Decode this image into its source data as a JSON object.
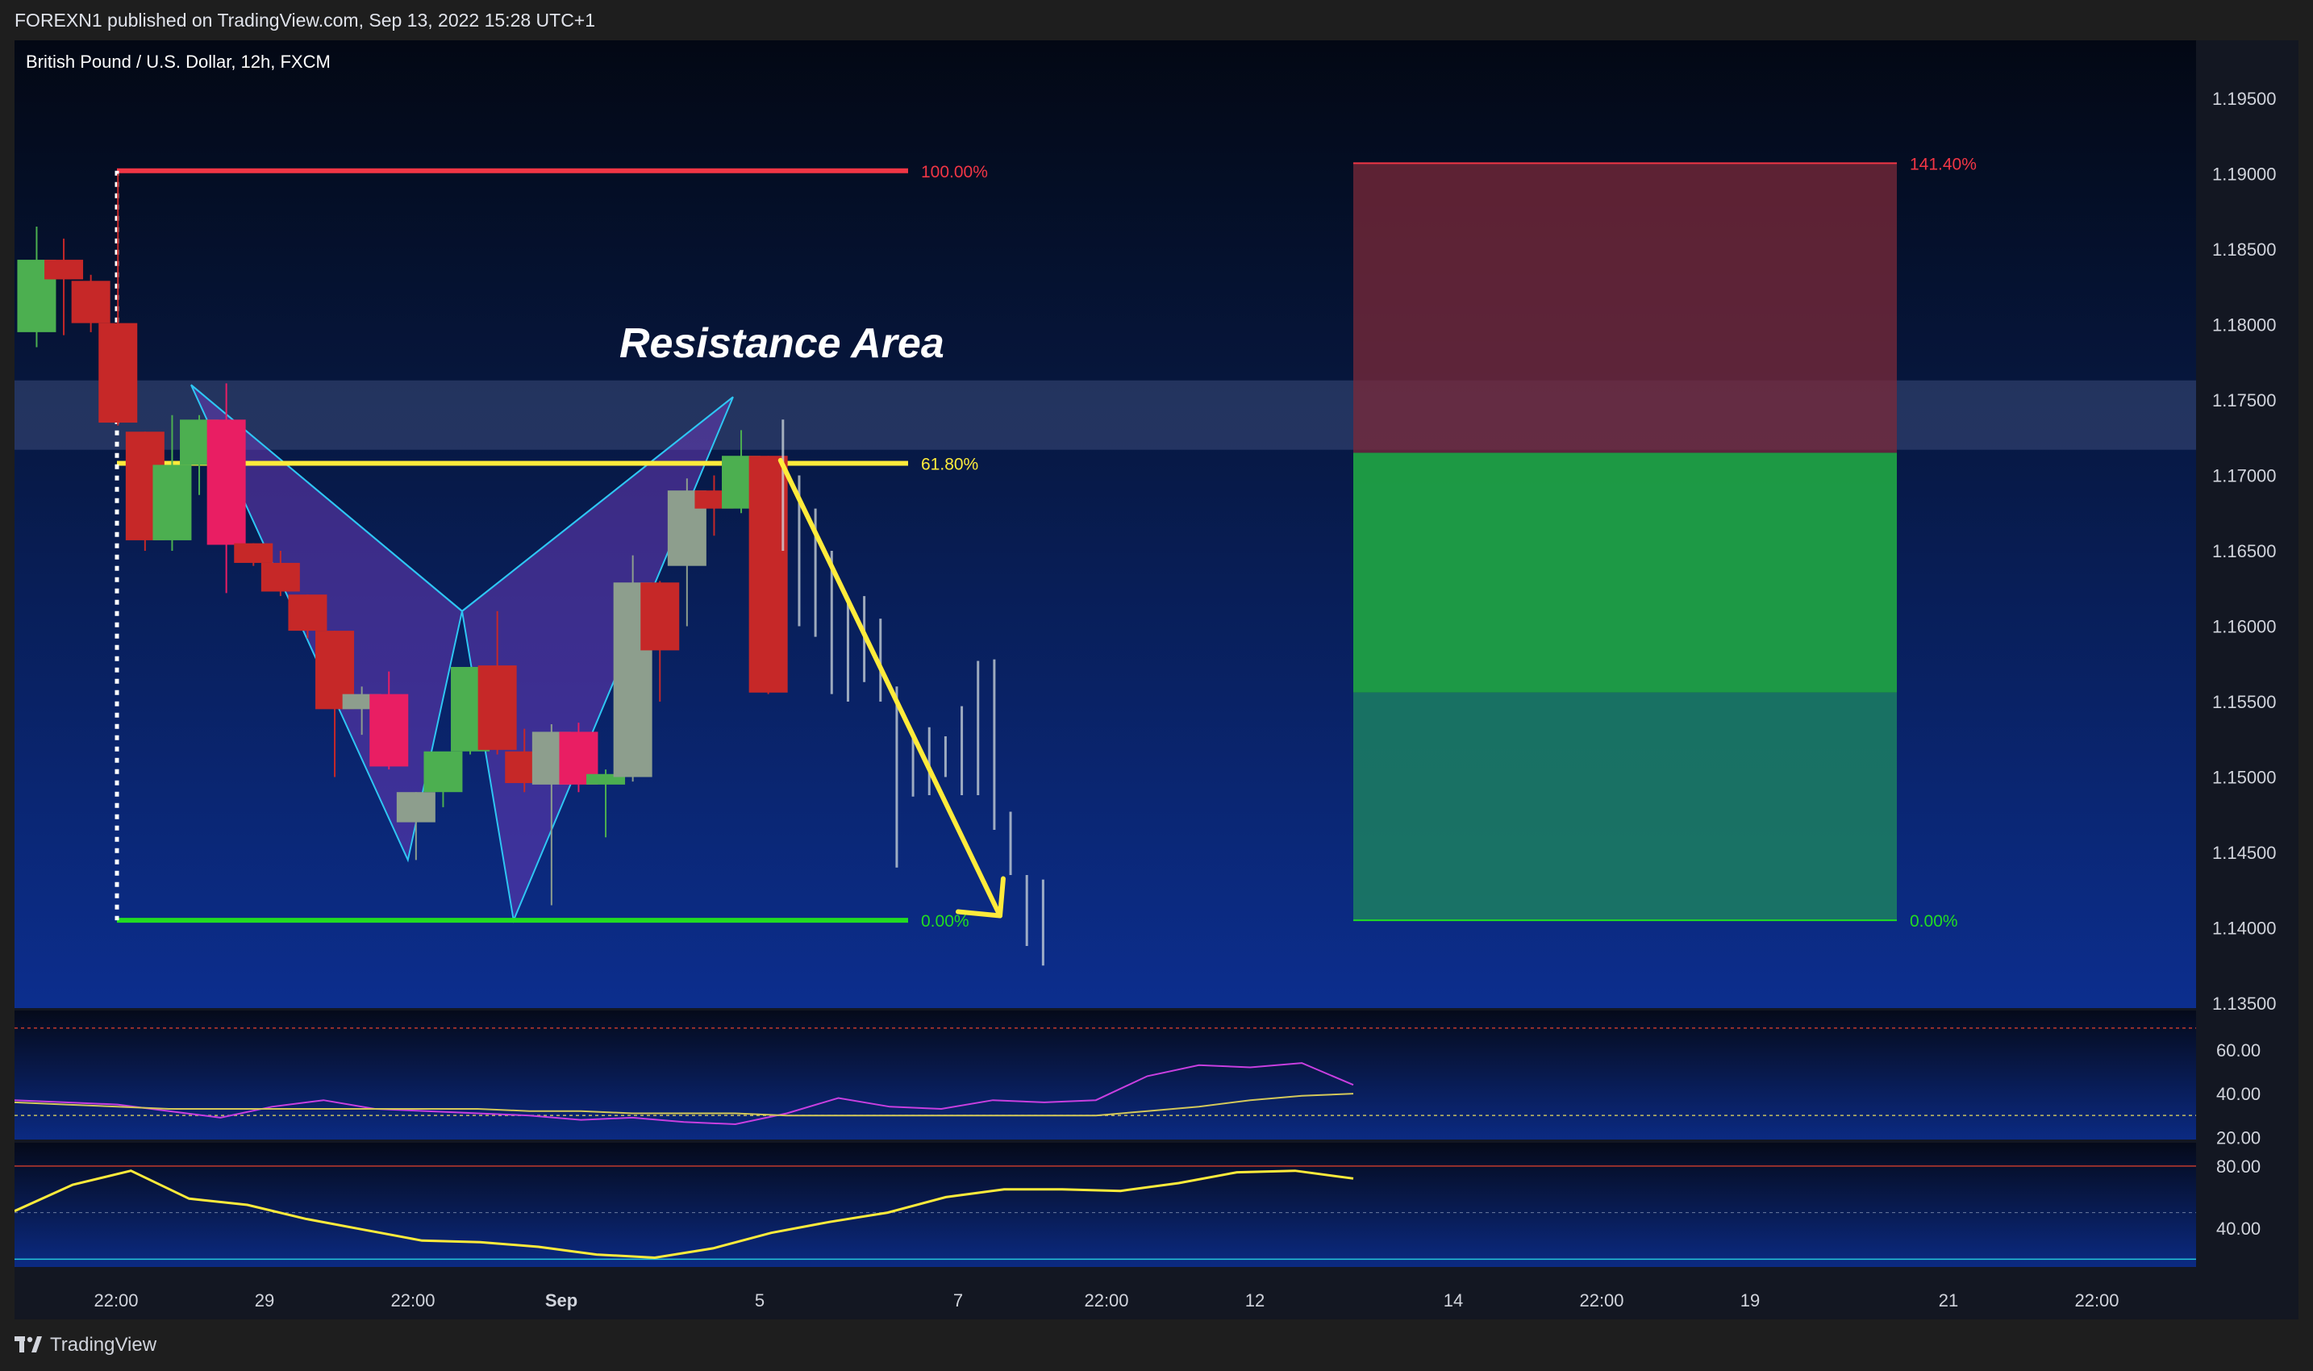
{
  "header": {
    "published": "FOREXN1 published on TradingView.com, Sep 13, 2022 15:28 UTC+1"
  },
  "chart": {
    "symbol_title": "British Pound / U.S. Dollar, 12h, FXCM"
  },
  "footer": {
    "logo_text": "TradingView"
  },
  "colors": {
    "up": "#4caf50",
    "down": "#c62828",
    "down_bright": "#e91e63",
    "neutral": "#8d9e8d",
    "fib_100": "#f23645",
    "fib_618": "#ffeb3b",
    "fib_0": "#22dd22",
    "pattern_fill": "#673ab7",
    "pattern_stroke": "#2ec6f3",
    "stop_zone": "#7b2a3a",
    "target_zone": "#1fa045",
    "target_zone_lower": "#1b7a63",
    "forecast_arrow": "#ffeb3b",
    "rsi_line": "#c83fe0",
    "rsi_signal": "#d4c85a",
    "stoch_line": "#ffeb3b"
  },
  "chart_data": [
    {
      "type": "candlestick",
      "title": "",
      "x_labels": [
        "22:00",
        "29",
        "22:00",
        "Sep",
        "5",
        "7",
        "22:00",
        "12",
        "14",
        "22:00",
        "19",
        "21",
        "22:00"
      ],
      "y_ticks": [
        "1.19500",
        "1.19000",
        "1.18500",
        "1.18000",
        "1.17500",
        "1.17000",
        "1.16500",
        "1.16000",
        "1.15500",
        "1.15000",
        "1.14500",
        "1.14000",
        "1.13500"
      ],
      "ylim": [
        1.1325,
        1.1985
      ],
      "candles": [
        {
          "o": 1.1795,
          "h": 1.1865,
          "l": 1.1785,
          "c": 1.1843
        },
        {
          "o": 1.1843,
          "h": 1.1857,
          "l": 1.1793,
          "c": 1.183
        },
        {
          "o": 1.1829,
          "h": 1.1833,
          "l": 1.1795,
          "c": 1.1801
        },
        {
          "o": 1.1801,
          "h": 1.19,
          "l": 1.1733,
          "c": 1.1735
        },
        {
          "o": 1.1729,
          "h": 1.1729,
          "l": 1.165,
          "c": 1.1657
        },
        {
          "o": 1.1657,
          "h": 1.174,
          "l": 1.165,
          "c": 1.1707
        },
        {
          "o": 1.1707,
          "h": 1.174,
          "l": 1.1687,
          "c": 1.1737
        },
        {
          "o": 1.1737,
          "h": 1.1761,
          "l": 1.1622,
          "c": 1.1654
        },
        {
          "o": 1.1655,
          "h": 1.1655,
          "l": 1.164,
          "c": 1.1642
        },
        {
          "o": 1.1642,
          "h": 1.165,
          "l": 1.162,
          "c": 1.1623
        },
        {
          "o": 1.1621,
          "h": 1.1621,
          "l": 1.1592,
          "c": 1.1597
        },
        {
          "o": 1.1597,
          "h": 1.1597,
          "l": 1.15,
          "c": 1.1545
        },
        {
          "o": 1.1545,
          "h": 1.156,
          "l": 1.1528,
          "c": 1.1555
        },
        {
          "o": 1.1555,
          "h": 1.157,
          "l": 1.1505,
          "c": 1.1507
        },
        {
          "o": 1.147,
          "h": 1.149,
          "l": 1.1445,
          "c": 1.149
        },
        {
          "o": 1.149,
          "h": 1.1515,
          "l": 1.148,
          "c": 1.1517
        },
        {
          "o": 1.1517,
          "h": 1.1565,
          "l": 1.1515,
          "c": 1.1573
        },
        {
          "o": 1.1574,
          "h": 1.161,
          "l": 1.1515,
          "c": 1.1518
        },
        {
          "o": 1.1517,
          "h": 1.1532,
          "l": 1.149,
          "c": 1.1496
        },
        {
          "o": 1.1495,
          "h": 1.1535,
          "l": 1.1415,
          "c": 1.153
        },
        {
          "o": 1.153,
          "h": 1.1536,
          "l": 1.149,
          "c": 1.1495
        },
        {
          "o": 1.1495,
          "h": 1.1505,
          "l": 1.146,
          "c": 1.1502
        },
        {
          "o": 1.15,
          "h": 1.1647,
          "l": 1.1497,
          "c": 1.1629
        },
        {
          "o": 1.1629,
          "h": 1.163,
          "l": 1.155,
          "c": 1.1584
        },
        {
          "o": 1.164,
          "h": 1.1698,
          "l": 1.16,
          "c": 1.169
        },
        {
          "o": 1.169,
          "h": 1.17,
          "l": 1.166,
          "c": 1.1678
        },
        {
          "o": 1.1678,
          "h": 1.173,
          "l": 1.1675,
          "c": 1.1713
        },
        {
          "o": 1.1713,
          "h": 1.1713,
          "l": 1.1555,
          "c": 1.1556
        }
      ],
      "pattern_points": [
        {
          "t": 6.1,
          "p": 1.176
        },
        {
          "t": 14.1,
          "p": 1.1445
        },
        {
          "t": 16.1,
          "p": 1.161
        },
        {
          "t": 18.0,
          "p": 1.1405
        },
        {
          "t": 26.1,
          "p": 1.1752
        }
      ],
      "fibonacci": [
        {
          "label": "100.00%",
          "price": 1.1902
        },
        {
          "label": "61.80%",
          "price": 1.1708
        },
        {
          "label": "0.00%",
          "price": 1.1405
        }
      ],
      "resistance_area": {
        "label": "Resistance Area",
        "top": 1.1763,
        "bottom": 1.1717
      },
      "position_tool": {
        "stop_label": "141.40%",
        "target_label": "0.00%",
        "stop_price": 1.1907,
        "entry_price": 1.1715,
        "mid_price": 1.1556,
        "target_price": 1.1405
      },
      "forecast_bars": [
        {
          "t": 28.0,
          "h": 1.1737,
          "l": 1.165
        },
        {
          "t": 28.6,
          "h": 1.17,
          "l": 1.16
        },
        {
          "t": 29.2,
          "h": 1.1678,
          "l": 1.1593
        },
        {
          "t": 29.8,
          "h": 1.165,
          "l": 1.1555
        },
        {
          "t": 30.4,
          "h": 1.1618,
          "l": 1.155
        },
        {
          "t": 31.0,
          "h": 1.162,
          "l": 1.1563
        },
        {
          "t": 31.6,
          "h": 1.1605,
          "l": 1.155
        },
        {
          "t": 32.2,
          "h": 1.156,
          "l": 1.144
        },
        {
          "t": 32.8,
          "h": 1.1527,
          "l": 1.1487
        },
        {
          "t": 33.4,
          "h": 1.1533,
          "l": 1.1488
        },
        {
          "t": 34.0,
          "h": 1.1527,
          "l": 1.15
        },
        {
          "t": 34.6,
          "h": 1.1547,
          "l": 1.1488
        },
        {
          "t": 35.2,
          "h": 1.1577,
          "l": 1.1488
        },
        {
          "t": 35.8,
          "h": 1.1578,
          "l": 1.1465
        },
        {
          "t": 36.4,
          "h": 1.1477,
          "l": 1.1435
        },
        {
          "t": 37.0,
          "h": 1.1435,
          "l": 1.1388
        },
        {
          "t": 37.6,
          "h": 1.1432,
          "l": 1.1375
        }
      ],
      "forecast_arrow": {
        "from": {
          "t": 28.0,
          "p": 1.171
        },
        "to": {
          "t": 36.1,
          "p": 1.1408
        }
      }
    },
    {
      "type": "line",
      "title": "",
      "y_ticks": [
        "60.00",
        "40.00",
        "20.00"
      ],
      "ylim": [
        19,
        78
      ],
      "series": [
        {
          "values": [
            37,
            36,
            35,
            32,
            29,
            34,
            37,
            33,
            32,
            31,
            30,
            28,
            29,
            27,
            26,
            31,
            38,
            34,
            33,
            37,
            36,
            37,
            48,
            53,
            52,
            54,
            44
          ]
        },
        {
          "values": [
            36,
            35,
            34,
            33,
            33,
            33,
            33,
            33,
            33,
            33,
            32,
            32,
            31,
            31,
            31,
            30,
            30,
            30,
            30,
            30,
            30,
            30,
            32,
            34,
            37,
            39,
            40
          ]
        }
      ]
    },
    {
      "type": "line",
      "title": "",
      "y_ticks": [
        "80.00",
        "40.00"
      ],
      "ylim": [
        15,
        95
      ],
      "series": [
        {
          "values": [
            51,
            68,
            77,
            59,
            55,
            46,
            39,
            32,
            31,
            28,
            23,
            21,
            27,
            37,
            44,
            50,
            60,
            65,
            65,
            64,
            69,
            76,
            77,
            72
          ]
        }
      ]
    }
  ]
}
